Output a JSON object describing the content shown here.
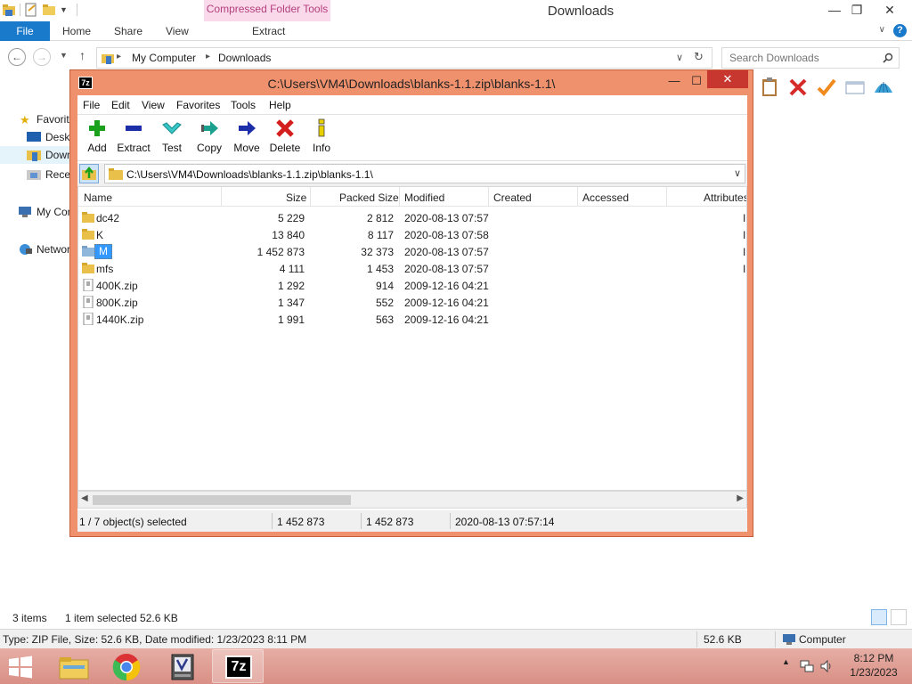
{
  "explorer": {
    "title": "Downloads",
    "context_tab_group": "Compressed Folder Tools",
    "tabs": {
      "file": "File",
      "home": "Home",
      "share": "Share",
      "view": "View",
      "extract": "Extract"
    },
    "breadcrumb": [
      "My Computer",
      "Downloads"
    ],
    "search_placeholder": "Search Downloads",
    "nav": {
      "favorites": "Favorites",
      "desktop": "Desktop",
      "downloads": "Downloads",
      "recent": "Recent places",
      "computer": "My Computer",
      "network": "Network"
    },
    "status": {
      "items": "3 items",
      "selected": "1 item selected  52.6 KB"
    },
    "details_bar": {
      "type": "Type: ZIP File, Size: 52.6 KB, Date modified: 1/23/2023 8:11 PM",
      "size": "52.6 KB",
      "location": "Computer"
    }
  },
  "sevenzip": {
    "title": "C:\\Users\\VM4\\Downloads\\blanks-1.1.zip\\blanks-1.1\\",
    "logo_text": "7z",
    "menu": [
      "File",
      "Edit",
      "View",
      "Favorites",
      "Tools",
      "Help"
    ],
    "toolbar": {
      "add": "Add",
      "extract": "Extract",
      "test": "Test",
      "copy": "Copy",
      "move": "Move",
      "delete": "Delete",
      "info": "Info"
    },
    "path": "C:\\Users\\VM4\\Downloads\\blanks-1.1.zip\\blanks-1.1\\",
    "columns": [
      "Name",
      "Size",
      "Packed Size",
      "Modified",
      "Created",
      "Accessed",
      "Attributes"
    ],
    "rows": [
      {
        "name": "dc42",
        "size": "5 229",
        "packed": "2 812",
        "modified": "2020-08-13 07:57",
        "kind": "folder",
        "attr": "I"
      },
      {
        "name": "K",
        "size": "13 840",
        "packed": "8 117",
        "modified": "2020-08-13 07:58",
        "kind": "folder",
        "attr": "I"
      },
      {
        "name": "M",
        "size": "1 452 873",
        "packed": "32 373",
        "modified": "2020-08-13 07:57",
        "kind": "folder",
        "attr": "I"
      },
      {
        "name": "mfs",
        "size": "4 111",
        "packed": "1 453",
        "modified": "2020-08-13 07:57",
        "kind": "folder",
        "attr": "I"
      },
      {
        "name": "400K.zip",
        "size": "1 292",
        "packed": "914",
        "modified": "2009-12-16 04:21",
        "kind": "file",
        "attr": ""
      },
      {
        "name": "800K.zip",
        "size": "1 347",
        "packed": "552",
        "modified": "2009-12-16 04:21",
        "kind": "file",
        "attr": ""
      },
      {
        "name": "1440K.zip",
        "size": "1 991",
        "packed": "563",
        "modified": "2009-12-16 04:21",
        "kind": "file",
        "attr": ""
      }
    ],
    "status": {
      "selection": "1 / 7 object(s) selected",
      "size": "1 452 873",
      "packed": "1 452 873",
      "modified": "2020-08-13 07:57:14"
    }
  },
  "taskbar": {
    "time": "8:12 PM",
    "date": "1/23/2023",
    "sevenzip_label": "7z"
  }
}
